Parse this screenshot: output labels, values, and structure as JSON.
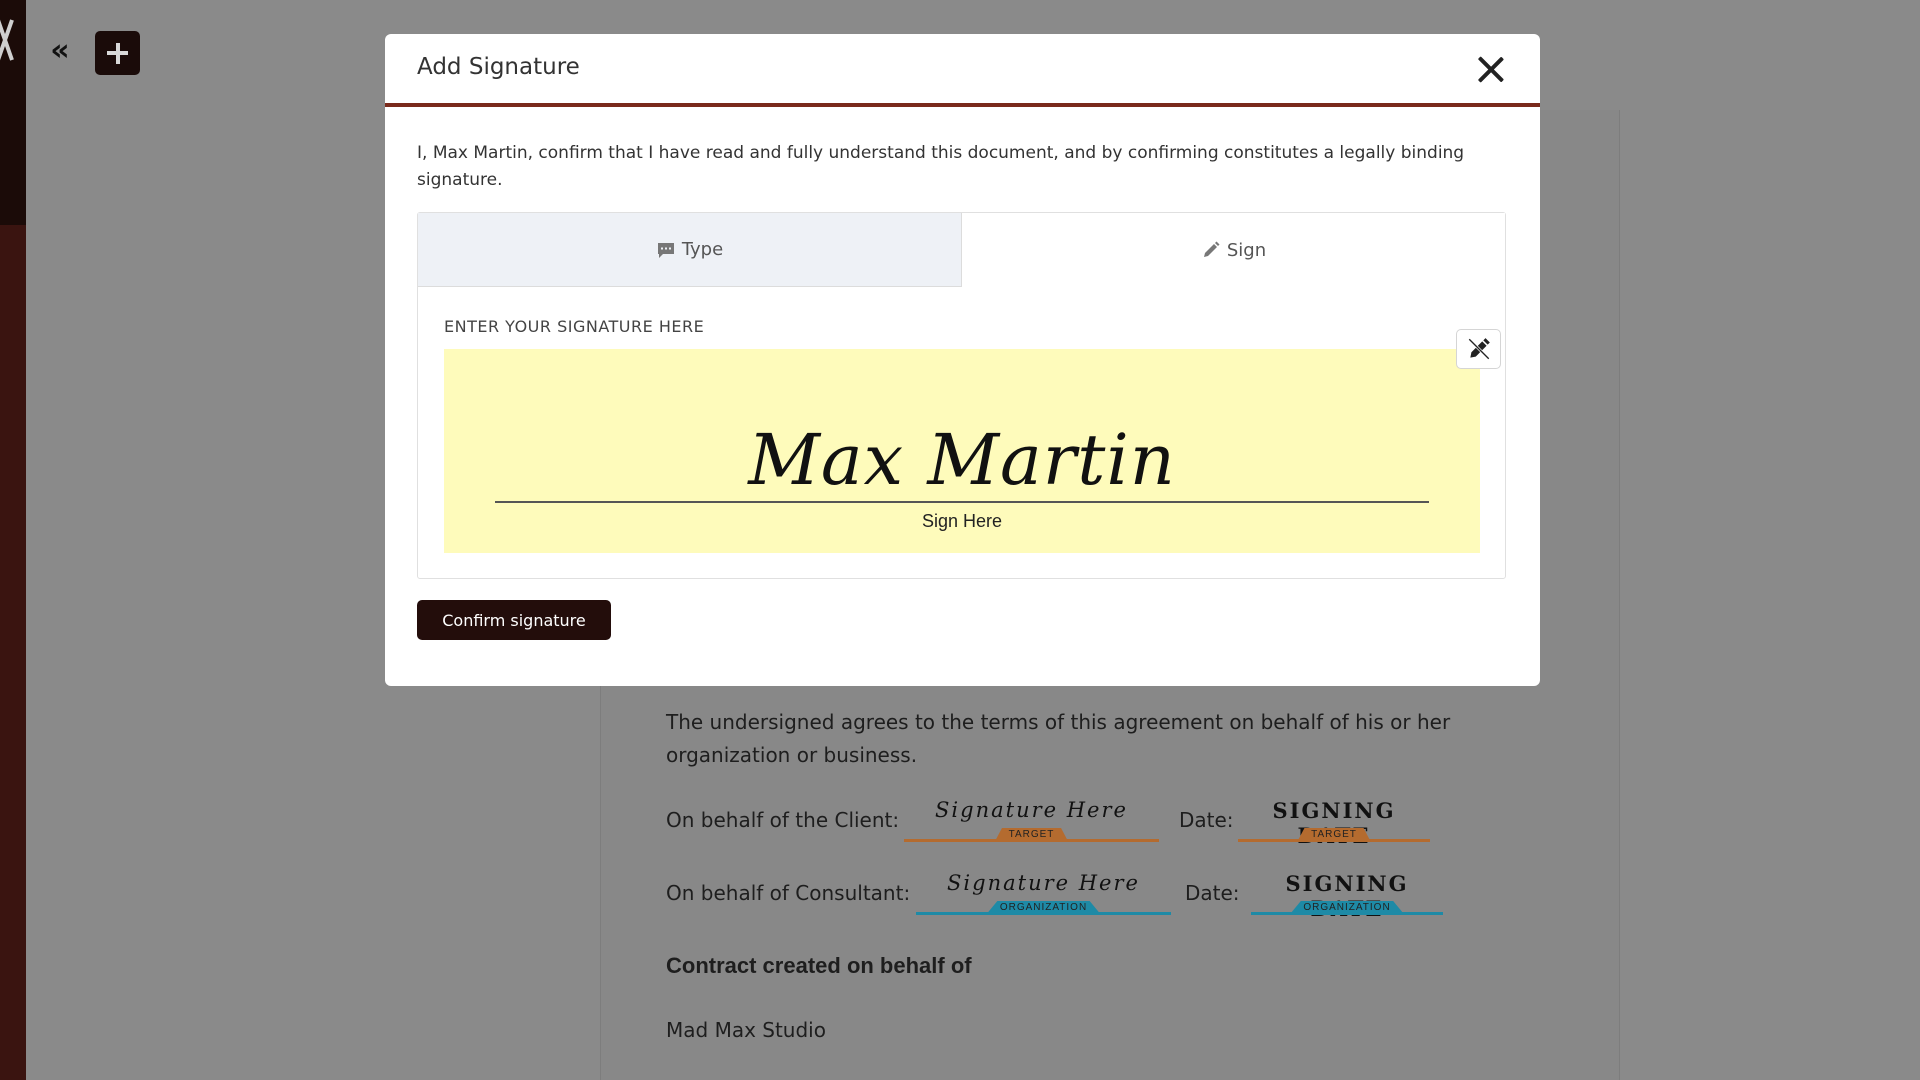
{
  "app": {
    "collapse_glyph": "«",
    "add_icon": "plus-icon",
    "collapse_icon": "double-chevron-left-icon"
  },
  "document": {
    "paragraph": "The undersigned agrees to the terms of this agreement on behalf of his or her organization or business.",
    "client_label": "On behalf of the Client:",
    "client_signature_placeholder": "Signature Here",
    "client_signature_tag": "TARGET",
    "client_date_label": "Date:",
    "client_date_placeholder": "SIGNING DATE",
    "client_date_tag": "TARGET",
    "consultant_label": "On behalf of Consultant:",
    "consultant_signature_placeholder": "Signature Here",
    "consultant_signature_tag": "ORGANIZATION",
    "consultant_date_label": "Date:",
    "consultant_date_placeholder": "SIGNING DATE",
    "consultant_date_tag": "ORGANIZATION",
    "created_heading": "Contract created on behalf of",
    "company_name": "Mad Max Studio"
  },
  "modal": {
    "title": "Add Signature",
    "confirmation_text": "I, Max Martin, confirm that I have read and fully understand this document, and by confirming constitutes a legally binding signature.",
    "tabs": [
      {
        "label": "Type",
        "icon": "chat-icon",
        "active": true
      },
      {
        "label": "Sign",
        "icon": "pencil-icon",
        "active": false
      }
    ],
    "instruction": "ENTER YOUR SIGNATURE HERE",
    "signature_value": "Max Martin",
    "signature_hint": "Sign Here",
    "confirm_label": "Confirm signature",
    "colors": {
      "accent": "#7a2a1c",
      "pad_background": "#fefbbb",
      "button": "#230d0b",
      "target_tag": "#b46b2f",
      "organization_tag": "#1e8aa6"
    }
  }
}
